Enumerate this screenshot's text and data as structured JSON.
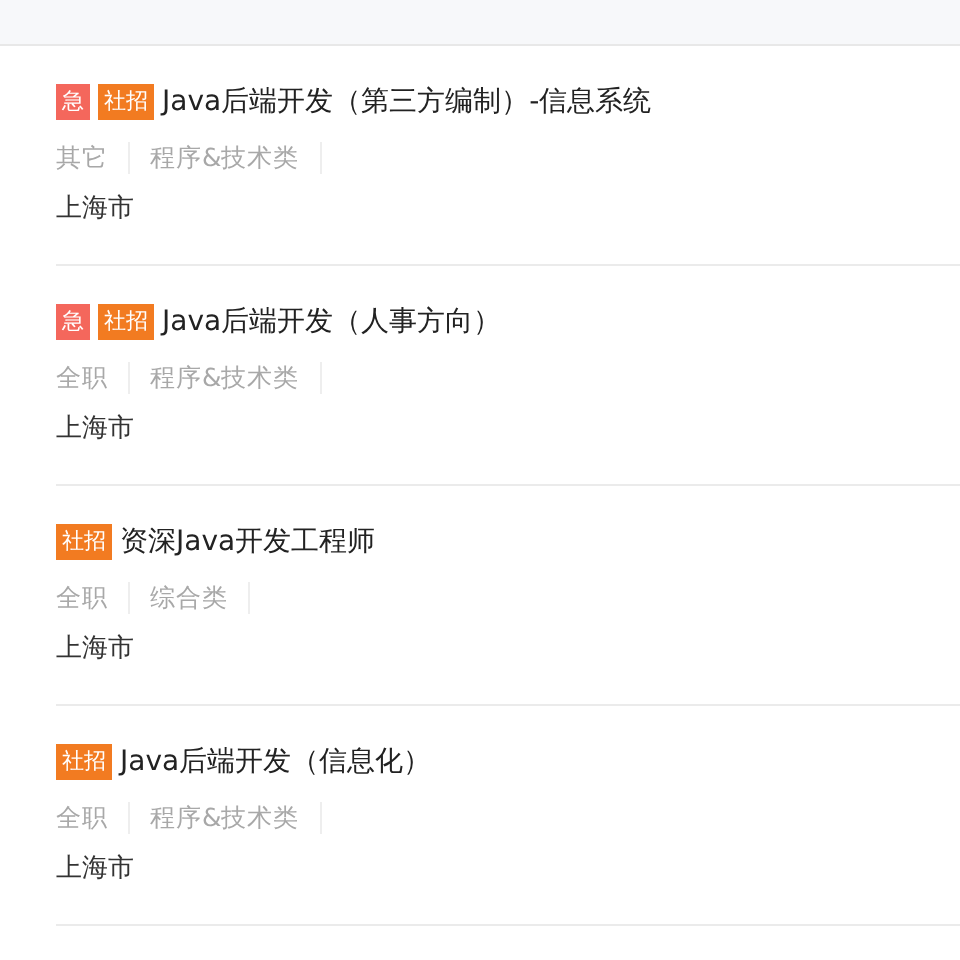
{
  "jobs": [
    {
      "tags": [
        {
          "text": "急",
          "kind": "urgent"
        },
        {
          "text": "社招",
          "kind": "hire"
        }
      ],
      "title": "Java后端开发（第三方编制）-信息系统",
      "meta": [
        "其它",
        "程序&技术类"
      ],
      "location": "上海市"
    },
    {
      "tags": [
        {
          "text": "急",
          "kind": "urgent"
        },
        {
          "text": "社招",
          "kind": "hire"
        }
      ],
      "title": "Java后端开发（人事方向）",
      "meta": [
        "全职",
        "程序&技术类"
      ],
      "location": "上海市"
    },
    {
      "tags": [
        {
          "text": "社招",
          "kind": "hire"
        }
      ],
      "title": "资深Java开发工程师",
      "meta": [
        "全职",
        "综合类"
      ],
      "location": "上海市"
    },
    {
      "tags": [
        {
          "text": "社招",
          "kind": "hire"
        }
      ],
      "title": "Java后端开发（信息化）",
      "meta": [
        "全职",
        "程序&技术类"
      ],
      "location": "上海市"
    }
  ]
}
